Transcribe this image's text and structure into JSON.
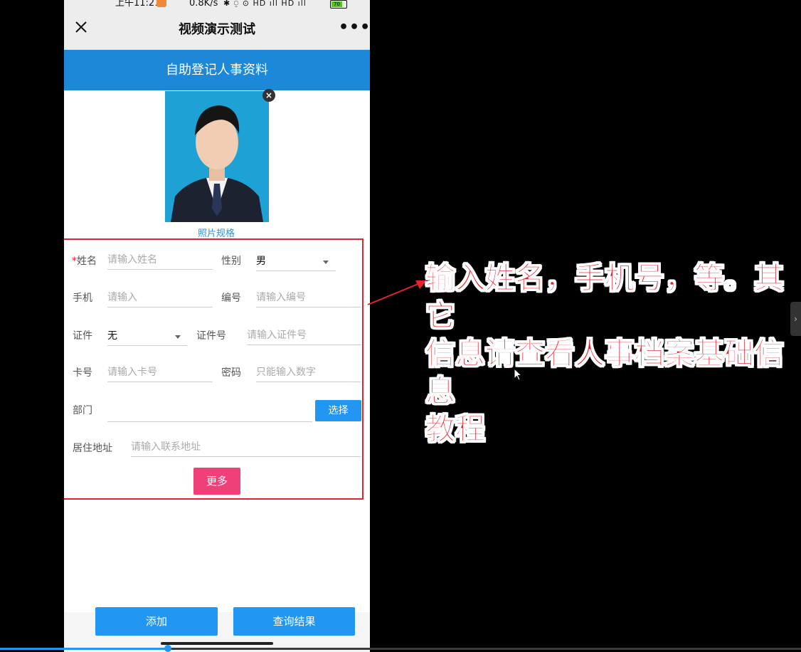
{
  "status_bar": {
    "time": "上午11:21",
    "net_speed": "0.8K/s",
    "icons": "✱ ⍜ ⊙ HD ıll HD ıll",
    "battery": "70"
  },
  "nav": {
    "close_icon": "close-icon",
    "title": "视频演示测试",
    "more": "•••"
  },
  "header": {
    "title": "自助登记人事资料"
  },
  "photo": {
    "spec_link": "照片规格",
    "remove": "×"
  },
  "form": {
    "name": {
      "label": "姓名",
      "required": "*",
      "placeholder": "请输入姓名"
    },
    "gender": {
      "label": "性别",
      "value": "男"
    },
    "phone": {
      "label": "手机",
      "placeholder": "请输入"
    },
    "number": {
      "label": "编号",
      "placeholder": "请输入编号"
    },
    "id_type": {
      "label": "证件",
      "value": "无"
    },
    "id_number": {
      "label": "证件号",
      "placeholder": "请输入证件号"
    },
    "card": {
      "label": "卡号",
      "placeholder": "请输入卡号"
    },
    "password": {
      "label": "密码",
      "placeholder": "只能输入数字"
    },
    "department": {
      "label": "部门",
      "button": "选择"
    },
    "address": {
      "label": "居住地址",
      "placeholder": "请输入联系地址"
    },
    "more_button": "更多"
  },
  "bottom": {
    "add_button": "添加",
    "query_button": "查询结果"
  },
  "annotation": {
    "text": "输入姓名，手机号，等。其它\n信息请查看人事档案基础信息\n教程",
    "color": "#e8202c"
  },
  "video_progress": 0.21,
  "colors": {
    "primary": "#1e88d8",
    "button": "#2196f3",
    "accent_pink": "#f0407a",
    "highlight_red": "#e32331"
  }
}
